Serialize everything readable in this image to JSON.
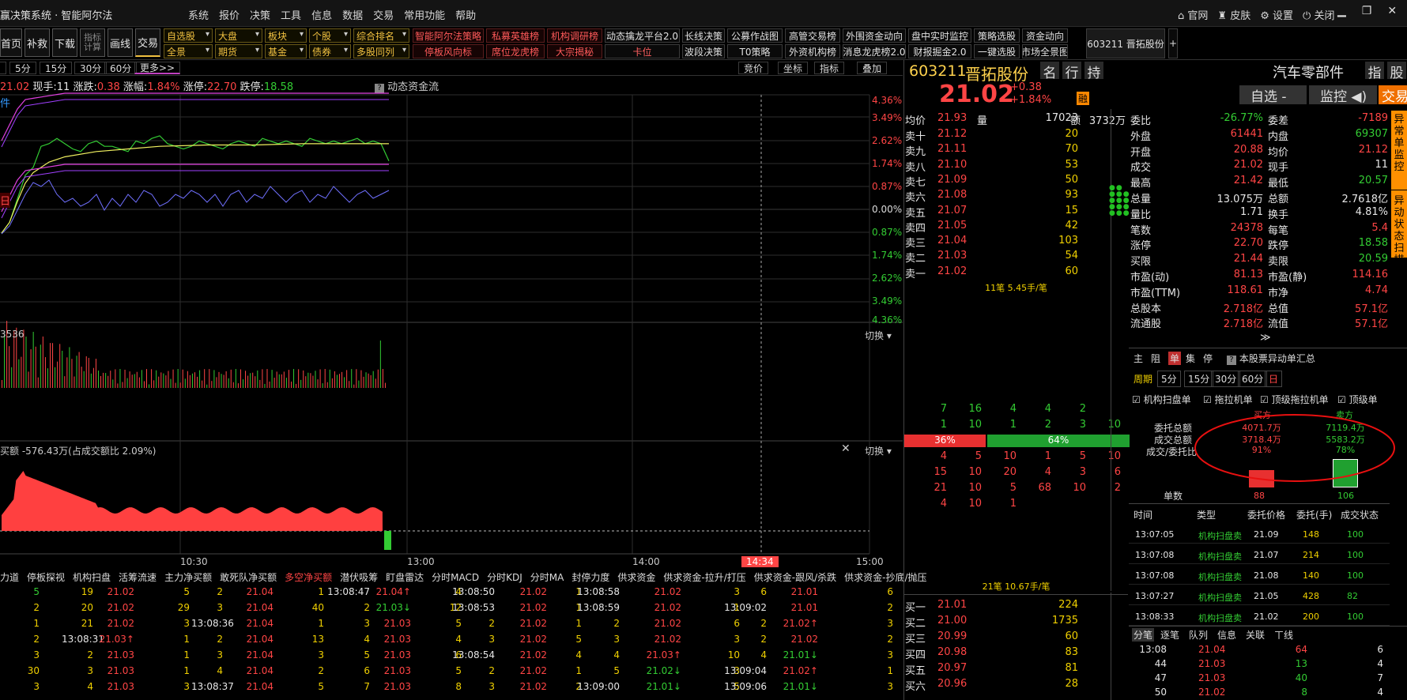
{
  "app": {
    "title": "赢决策系统 · 智能阿尔法",
    "menu": [
      "系统",
      "报价",
      "决策",
      "工具",
      "信息",
      "数据",
      "交易",
      "常用功能",
      "帮助"
    ],
    "links": [
      "官网",
      "皮肤",
      "设置",
      "关闭"
    ]
  },
  "toolbar": {
    "big": [
      "首页",
      "补救",
      "下载",
      "指标计算",
      "画线",
      "交易"
    ],
    "dd1": [
      "自选股",
      "大盘",
      "板块",
      "个股",
      "综合排名"
    ],
    "dd2": [
      "全景",
      "期货",
      "基金",
      "债券",
      "多股同列"
    ],
    "red1": [
      "智能阿尔法策略",
      "私募英雄榜",
      "机构调研榜"
    ],
    "red2": [
      "停板风向标",
      "席位龙虎榜",
      "大宗揭秘"
    ],
    "w1": [
      "动态擒龙平台2.0",
      "长线决策",
      "公募作战图",
      "高管交易榜",
      "外围资金动向",
      "盘中实时监控",
      "策略选股",
      "资金动向"
    ],
    "w2": [
      "卡位",
      "波段决策",
      "T0策略",
      "外资机构榜",
      "消息龙虎榜2.0",
      "财报掘金2.0",
      "一键选股",
      "市场全景图"
    ],
    "stock_tab": "603211 晋拓股份",
    "plus": "+"
  },
  "periodbar": {
    "tabs": [
      "5分",
      "15分",
      "30分",
      "60分",
      "更多>>"
    ],
    "right": [
      "竞价",
      "坐标",
      "指标",
      "叠加"
    ]
  },
  "chart": {
    "info": {
      "price": "21.02",
      "now_label": "现手:",
      "now": "11",
      "chg_label": "涨跌:",
      "chg": "0.38",
      "pct_label": "涨幅:",
      "pct": "1.84%",
      "up_label": "涨停:",
      "up": "22.70",
      "dn_label": "跌停:",
      "dn": "18.58",
      "flow": "动态资金流"
    },
    "left_mark1": "件",
    "left_mark2": "日",
    "pct_axis": [
      "4.36%",
      "3.49%",
      "2.62%",
      "1.74%",
      "0.87%",
      "0.00%",
      "0.87%",
      "1.74%",
      "2.62%",
      "3.49%",
      "4.36%"
    ],
    "vol_label": "3536",
    "switch": "切换",
    "flow_label": "买额 -576.43万(占成交额比 2.09%)",
    "time_labels": [
      "10:30",
      "13:00",
      "14:00",
      "15:00"
    ],
    "cursor_time": "14:34"
  },
  "chart_data": [
    {
      "type": "line",
      "title": "",
      "series": [
        {
          "name": "",
          "x": [
            0,
            10,
            20,
            30,
            40,
            50,
            60,
            70,
            80,
            90,
            100,
            110,
            120,
            130,
            140,
            150,
            160,
            170,
            180,
            190,
            200,
            210,
            220,
            230,
            240,
            250,
            260,
            270,
            280,
            290,
            300,
            310,
            320,
            330,
            340,
            350,
            360,
            370,
            380,
            390,
            400,
            410,
            420,
            430,
            440,
            450,
            460,
            470,
            480,
            490
          ],
          "y": [
            -0.9,
            -0.5,
            0.4,
            1.3,
            1.6,
            2.4,
            2.5,
            2.7,
            2.5,
            2.3,
            2.2,
            2.5,
            2.6,
            2.4,
            2.4,
            2.3,
            2.2,
            2.6,
            2.5,
            2.7,
            2.8,
            2.5,
            2.4,
            2.3,
            2.4,
            2.6,
            2.5,
            2.4,
            2.3,
            2.5,
            2.6,
            2.5,
            2.4,
            2.7,
            2.6,
            2.5,
            2.6,
            2.5,
            2.4,
            2.7,
            2.6,
            2.5,
            2.6,
            2.5,
            2.6,
            2.7,
            2.5,
            2.6,
            2.5,
            1.84
          ]
        },
        {
          "name": "",
          "x": [
            0,
            10,
            20,
            30,
            40,
            60,
            80,
            120,
            160,
            200,
            260,
            320,
            380,
            440,
            490
          ],
          "y": [
            -0.9,
            -0.5,
            0.3,
            1.0,
            1.4,
            1.8,
            2.0,
            2.2,
            2.3,
            2.4,
            2.45,
            2.45,
            2.5,
            2.5,
            2.5
          ]
        }
      ],
      "ylim": [
        -4.36,
        4.36
      ]
    },
    {
      "type": "bar",
      "title": "",
      "ylim": [
        0,
        3536
      ]
    },
    {
      "type": "area",
      "title": "",
      "ylabel": "买额"
    }
  ],
  "quote": {
    "code": "603211",
    "name": "晋拓股份",
    "btns": [
      "名",
      "行",
      "持"
    ],
    "industry": "汽车零部件",
    "idx_btns": [
      "指",
      "股"
    ],
    "price": "21.02",
    "chg": "+0.38",
    "pct": "+1.84%",
    "tag": "融",
    "zixuan": "自选",
    "jiankong": "监控",
    "jiaoyi": "交易",
    "avg_label": "均价",
    "avg": "21.93",
    "vol_label": "量",
    "vol": "17023",
    "amt_label": "额",
    "amt": "3732万",
    "sells": [
      [
        "卖十",
        "21.12",
        "20"
      ],
      [
        "卖九",
        "21.11",
        "70"
      ],
      [
        "卖八",
        "21.10",
        "53"
      ],
      [
        "卖七",
        "21.09",
        "50"
      ],
      [
        "卖六",
        "21.08",
        "93"
      ],
      [
        "卖五",
        "21.07",
        "15"
      ],
      [
        "卖四",
        "21.05",
        "42"
      ],
      [
        "卖三",
        "21.04",
        "103"
      ],
      [
        "卖二",
        "21.03",
        "54"
      ],
      [
        "卖一",
        "21.02",
        "60"
      ]
    ],
    "sell_summary": "11笔 5.45手/笔",
    "queue_up": [
      [
        "7",
        "16",
        "4",
        "4",
        "2"
      ],
      [
        "1",
        "10",
        "1",
        "2",
        "3",
        "10"
      ]
    ],
    "ratio_left": "36%",
    "ratio_right": "64%",
    "queue_dn": [
      [
        "4",
        "5",
        "10",
        "1",
        "5",
        "10"
      ],
      [
        "15",
        "10",
        "20",
        "4",
        "3",
        "6"
      ],
      [
        "21",
        "10",
        "5",
        "68",
        "10",
        "2"
      ],
      [
        "4",
        "10",
        "1"
      ]
    ],
    "buy_summary": "21笔 10.67手/笔",
    "buys": [
      [
        "买一",
        "21.01",
        "224"
      ],
      [
        "买二",
        "21.00",
        "1735"
      ],
      [
        "买三",
        "20.99",
        "60"
      ],
      [
        "买四",
        "20.98",
        "83"
      ],
      [
        "买五",
        "20.97",
        "81"
      ],
      [
        "买六",
        "20.96",
        "28"
      ]
    ]
  },
  "stats": {
    "rows": [
      [
        "委比",
        "-26.77%",
        "委差",
        "-7189"
      ],
      [
        "外盘",
        "61441",
        "内盘",
        "69307"
      ],
      [
        "开盘",
        "20.88",
        "均价",
        "21.12"
      ],
      [
        "成交",
        "21.02",
        "现手",
        "11"
      ],
      [
        "最高",
        "21.42",
        "最低",
        "20.57"
      ],
      [
        "总量",
        "13.075万",
        "总额",
        "2.7618亿"
      ],
      [
        "量比",
        "1.71",
        "换手",
        "4.81%"
      ],
      [
        "笔数",
        "24378",
        "每笔",
        "5.4"
      ],
      [
        "涨停",
        "22.70",
        "跌停",
        "18.58"
      ],
      [
        "买限",
        "21.44",
        "卖限",
        "20.59"
      ],
      [
        "市盈(动)",
        "81.13",
        "市盈(静)",
        "114.16"
      ],
      [
        "市盈(TTM)",
        "118.61",
        "市净",
        "4.74"
      ],
      [
        "总股本",
        "2.718亿",
        "总值",
        "57.1亿"
      ],
      [
        "流通股",
        "2.718亿",
        "流值",
        "57.1亿"
      ]
    ],
    "side_tabs": [
      "异常单监控",
      "异动状态扫描"
    ],
    "expand": "≫"
  },
  "orders": {
    "tabs": [
      "主",
      "阻",
      "单",
      "集",
      "停"
    ],
    "summary_link": "本股票异动单汇总",
    "period_label": "周期",
    "periods": [
      "5分",
      "15分",
      "30分",
      "60分",
      "日"
    ],
    "checks": [
      "机构扫盘单",
      "拖拉机单",
      "顶级拖拉机单",
      "顶级单"
    ],
    "buy_label": "买方",
    "sell_label": "卖方",
    "summary_rows": [
      [
        "委托总额",
        "4071.7万",
        "7119.4万"
      ],
      [
        "成交总额",
        "3718.4万",
        "5583.2万"
      ],
      [
        "成交/委托比",
        "91%",
        "78%"
      ]
    ],
    "count_label": "单数",
    "buy_count": "88",
    "sell_count": "106",
    "table_headers": [
      "时间",
      "类型",
      "委托价格",
      "委托(手)",
      "成交状态"
    ],
    "table_rows": [
      [
        "13:07:05",
        "机构扫盘卖",
        "21.09",
        "148",
        "100"
      ],
      [
        "13:07:08",
        "机构扫盘卖",
        "21.07",
        "214",
        "100"
      ],
      [
        "13:07:08",
        "机构扫盘卖",
        "21.08",
        "140",
        "100"
      ],
      [
        "13:07:27",
        "机构扫盘卖",
        "21.05",
        "428",
        "82"
      ],
      [
        "13:08:33",
        "机构扫盘卖",
        "21.02",
        "200",
        "100"
      ]
    ]
  },
  "ticks": {
    "tabs": [
      "分笔",
      "逐笔",
      "队列",
      "信息",
      "关联",
      "ㄒ线"
    ],
    "rows": [
      [
        "13:08",
        "21.04",
        "64",
        "6"
      ],
      [
        "44",
        "21.03",
        "13",
        "4"
      ],
      [
        "47",
        "21.03",
        "40",
        "7"
      ],
      [
        "50",
        "21.02",
        "8",
        "4"
      ]
    ]
  },
  "bottom": {
    "headers": [
      "力道",
      "停板探视",
      "机构扫盘",
      "活筹流速",
      "主力净买额",
      "敢死队净买额",
      "多空净买额",
      "潜伏吸筹",
      "盯盘雷达",
      "分时MACD",
      "分时KDJ",
      "分时MA",
      "封停力度",
      "供求资金",
      "供求资金-拉升/打压",
      "供求资金-跟风/杀跌",
      "供求资金-抄底/抛压"
    ],
    "rows": [
      [
        "5",
        "19",
        "21.02",
        "5",
        "2",
        "21.04",
        "1",
        "13:08:47",
        "21.04↑",
        "4",
        "13:08:50",
        "21.02",
        "1",
        "13:08:58",
        "21.02",
        "3",
        "6",
        "21.01",
        "6"
      ],
      [
        "2",
        "20",
        "21.02",
        "29",
        "3",
        "21.04",
        "40",
        "2",
        "21.03↓",
        "12",
        "13:08:53",
        "21.02",
        "1",
        "13:08:59",
        "21.02",
        "1",
        "13:09:02",
        "21.01",
        "2"
      ],
      [
        "1",
        "21",
        "21.02",
        "3",
        "13:08:36",
        "21.04",
        "1",
        "3",
        "21.03",
        "5",
        "2",
        "21.02",
        "1",
        "2",
        "21.02",
        "6",
        "2",
        "21.02↑",
        "3"
      ],
      [
        "2",
        "13:08:31",
        "21.03↑",
        "1",
        "2",
        "21.04",
        "13",
        "4",
        "21.03",
        "4",
        "3",
        "21.02",
        "5",
        "3",
        "21.02",
        "3",
        "2",
        "21.02",
        "2"
      ],
      [
        "3",
        "2",
        "21.03",
        "1",
        "3",
        "21.04",
        "3",
        "5",
        "21.03",
        "6",
        "13:08:54",
        "21.02",
        "4",
        "4",
        "21.03↑",
        "10",
        "4",
        "21.01↓",
        "3"
      ],
      [
        "30",
        "3",
        "21.03",
        "1",
        "4",
        "21.04",
        "2",
        "6",
        "21.03",
        "5",
        "2",
        "21.02",
        "1",
        "5",
        "21.02↓",
        "3",
        "13:09:04",
        "21.02↑",
        "1"
      ],
      [
        "3",
        "4",
        "21.03",
        "3",
        "13:08:37",
        "21.04",
        "5",
        "7",
        "21.03",
        "8",
        "3",
        "21.02",
        "2",
        "13:09:00",
        "21.01↓",
        "5",
        "13:09:06",
        "21.01↓",
        "3"
      ]
    ]
  }
}
